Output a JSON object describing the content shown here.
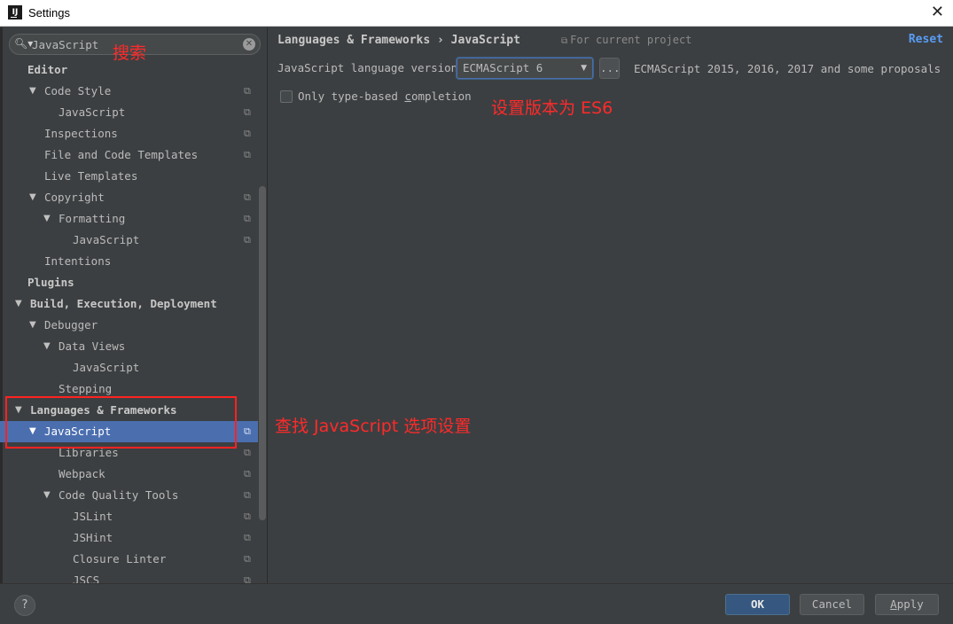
{
  "window": {
    "title": "Settings",
    "close": "✕",
    "app_icon_text": "IJ"
  },
  "search": {
    "value": "JavaScript",
    "icon": "search-icon",
    "clear": "✕"
  },
  "tree": [
    {
      "label": "Editor",
      "depth": 0,
      "arrow": false,
      "bold": true,
      "proj": false
    },
    {
      "label": "Code Style",
      "depth": 1,
      "arrow": true,
      "bold": false,
      "proj": true
    },
    {
      "label": "JavaScript",
      "depth": 2,
      "arrow": false,
      "bold": false,
      "proj": true
    },
    {
      "label": "Inspections",
      "depth": 1,
      "arrow": false,
      "bold": false,
      "proj": true
    },
    {
      "label": "File and Code Templates",
      "depth": 1,
      "arrow": false,
      "bold": false,
      "proj": true
    },
    {
      "label": "Live Templates",
      "depth": 1,
      "arrow": false,
      "bold": false,
      "proj": false
    },
    {
      "label": "Copyright",
      "depth": 1,
      "arrow": true,
      "bold": false,
      "proj": true
    },
    {
      "label": "Formatting",
      "depth": 2,
      "arrow": true,
      "bold": false,
      "proj": true
    },
    {
      "label": "JavaScript",
      "depth": 3,
      "arrow": false,
      "bold": false,
      "proj": true
    },
    {
      "label": "Intentions",
      "depth": 1,
      "arrow": false,
      "bold": false,
      "proj": false
    },
    {
      "label": "Plugins",
      "depth": 0,
      "arrow": false,
      "bold": true,
      "proj": false
    },
    {
      "label": "Build, Execution, Deployment",
      "depth": 0,
      "arrow": true,
      "bold": true,
      "proj": false
    },
    {
      "label": "Debugger",
      "depth": 1,
      "arrow": true,
      "bold": false,
      "proj": false
    },
    {
      "label": "Data Views",
      "depth": 2,
      "arrow": true,
      "bold": false,
      "proj": false
    },
    {
      "label": "JavaScript",
      "depth": 3,
      "arrow": false,
      "bold": false,
      "proj": false
    },
    {
      "label": "Stepping",
      "depth": 2,
      "arrow": false,
      "bold": false,
      "proj": false
    },
    {
      "label": "Languages & Frameworks",
      "depth": 0,
      "arrow": true,
      "bold": true,
      "proj": false
    },
    {
      "label": "JavaScript",
      "depth": 1,
      "arrow": true,
      "bold": false,
      "proj": true,
      "selected": true
    },
    {
      "label": "Libraries",
      "depth": 2,
      "arrow": false,
      "bold": false,
      "proj": true
    },
    {
      "label": "Webpack",
      "depth": 2,
      "arrow": false,
      "bold": false,
      "proj": true
    },
    {
      "label": "Code Quality Tools",
      "depth": 2,
      "arrow": true,
      "bold": false,
      "proj": true
    },
    {
      "label": "JSLint",
      "depth": 3,
      "arrow": false,
      "bold": false,
      "proj": true
    },
    {
      "label": "JSHint",
      "depth": 3,
      "arrow": false,
      "bold": false,
      "proj": true
    },
    {
      "label": "Closure Linter",
      "depth": 3,
      "arrow": false,
      "bold": false,
      "proj": true
    },
    {
      "label": "JSCS",
      "depth": 3,
      "arrow": false,
      "bold": false,
      "proj": true
    }
  ],
  "content": {
    "breadcrumb": "Languages & Frameworks › JavaScript",
    "scope": "For current project",
    "reset": "Reset",
    "lang_label": "JavaScript language version",
    "lang_value": "ECMAScript 6",
    "dots": "...",
    "lang_desc": "ECMAScript 2015, 2016, 2017 and some proposals",
    "checkbox_pre": "Only type-based ",
    "checkbox_u": "c",
    "checkbox_post": "ompletion",
    "checkbox_checked": false
  },
  "annotations": {
    "search": "搜索",
    "version": "设置版本为 ES6",
    "find": "查找 JavaScript 选项设置",
    "color": "#ff2a2a"
  },
  "footer": {
    "help": "?",
    "ok": "OK",
    "cancel": "Cancel",
    "apply_u": "A",
    "apply_rest": "pply"
  },
  "colors": {
    "background": "#3c3f41",
    "selection": "#4b6eaf",
    "link": "#589df6",
    "ok_button": "#365880"
  }
}
